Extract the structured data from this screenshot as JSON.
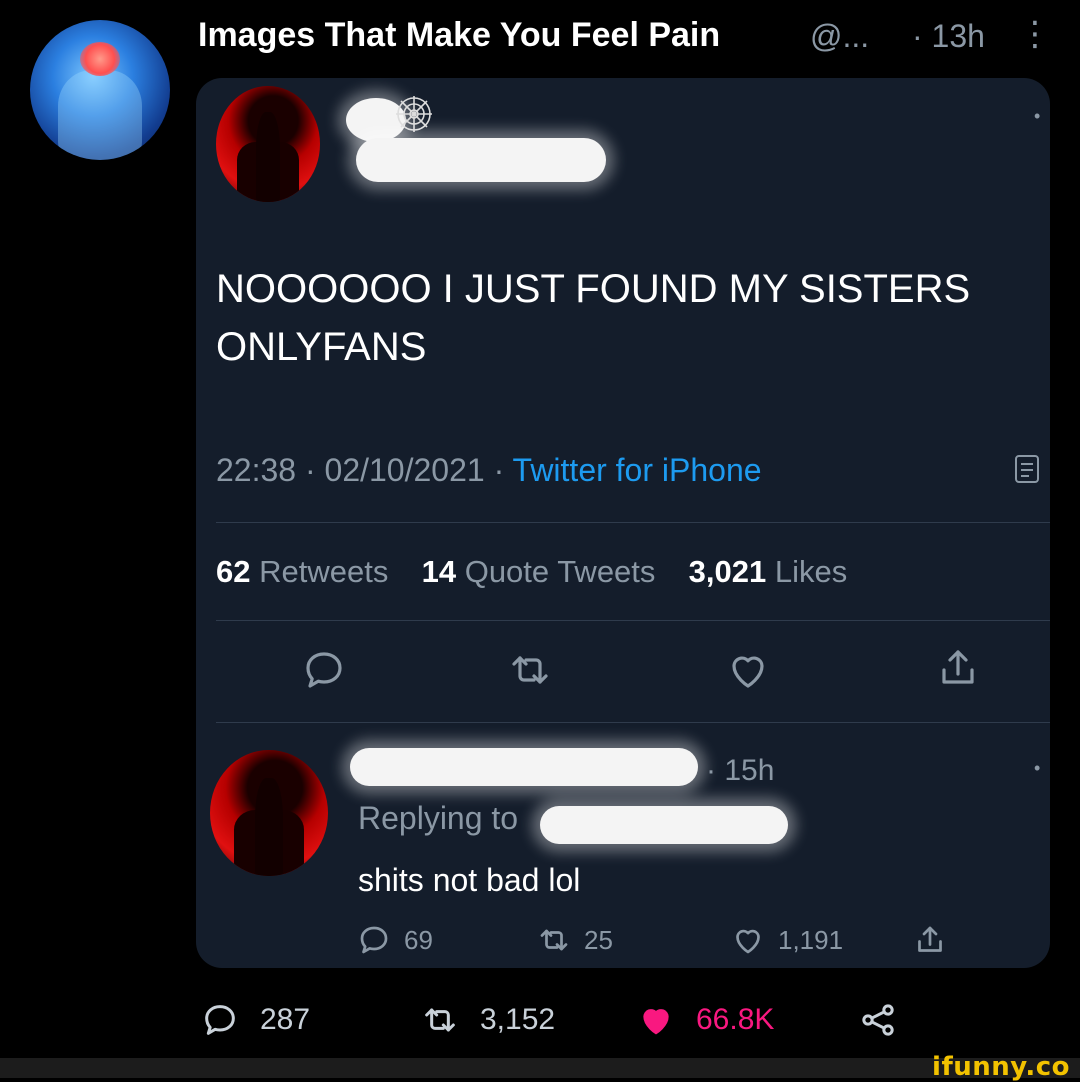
{
  "outer_tweet": {
    "author_name": "Images That Make You Feel Pain",
    "author_handle": "@...",
    "time": "· 13h",
    "more": "⋮",
    "avatar_icon": "brain-pain-avatar-icon",
    "actions": {
      "replies": "287",
      "retweets": "3,152",
      "likes": "66.8K",
      "like_color": "#f91880"
    }
  },
  "embedded_tweet": {
    "text": "NOOOOOO I JUST FOUND MY SISTERS ONLYFANS",
    "timestamp": "22:38 · 02/10/2021 ·",
    "source": "Twitter for iPhone",
    "source_color": "#1d9bf0",
    "stats": {
      "retweets_count": "62",
      "retweets_label": "Retweets",
      "quotes_count": "14",
      "quotes_label": "Quote Tweets",
      "likes_count": "3,021",
      "likes_label": "Likes"
    },
    "reply": {
      "time": "· 15h",
      "replying_to_label": "Replying to",
      "text": "shits not bad lol",
      "replies": "69",
      "retweets": "25",
      "likes": "1,191"
    },
    "card_background": "#141d2b"
  },
  "watermark": "ifunny.co"
}
